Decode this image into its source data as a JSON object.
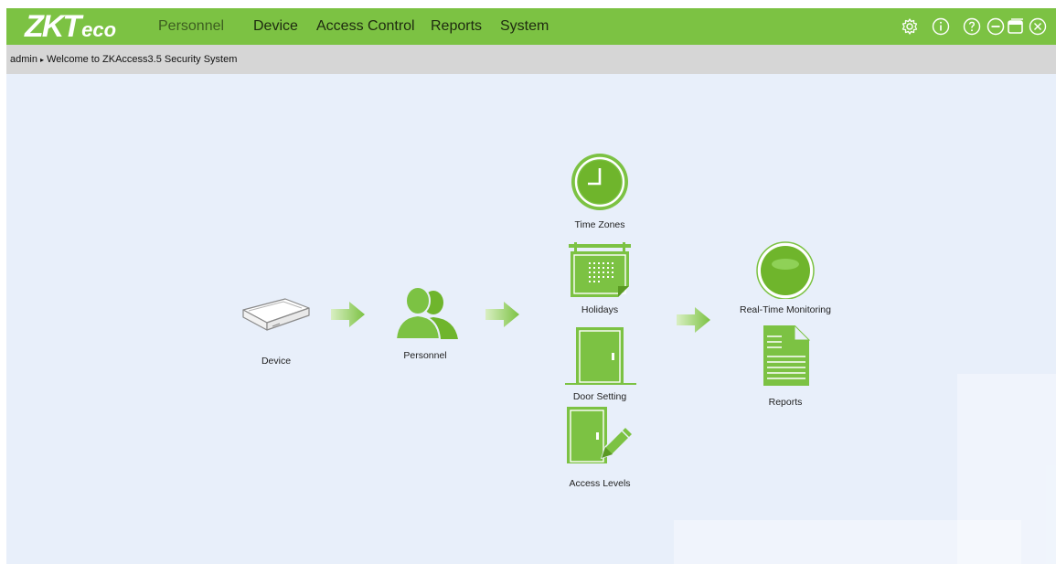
{
  "app": {
    "logo_main": "ZKT",
    "logo_sub": "eco"
  },
  "menu": {
    "items": [
      {
        "label": "Personnel"
      },
      {
        "label": "Device"
      },
      {
        "label": "Access Control"
      },
      {
        "label": "Reports"
      },
      {
        "label": "System"
      }
    ]
  },
  "window_icons": [
    "settings-icon",
    "info-icon",
    "help-icon",
    "minimize-icon",
    "restore-icon",
    "close-icon"
  ],
  "breadcrumb": {
    "user": "admin",
    "separator": "▸",
    "welcome": "Welcome to ZKAccess3.5 Security System"
  },
  "flow": {
    "device": "Device",
    "personnel": "Personnel",
    "time_zones": "Time Zones",
    "holidays": "Holidays",
    "door_setting": "Door Setting",
    "access_levels": "Access Levels",
    "real_time_monitoring": "Real-Time Monitoring",
    "reports": "Reports"
  },
  "colors": {
    "brand_green": "#7cc243",
    "icon_green": "#6fb52c",
    "background": "#e8effa",
    "breadcrumb_bg": "#d6d6d6"
  }
}
